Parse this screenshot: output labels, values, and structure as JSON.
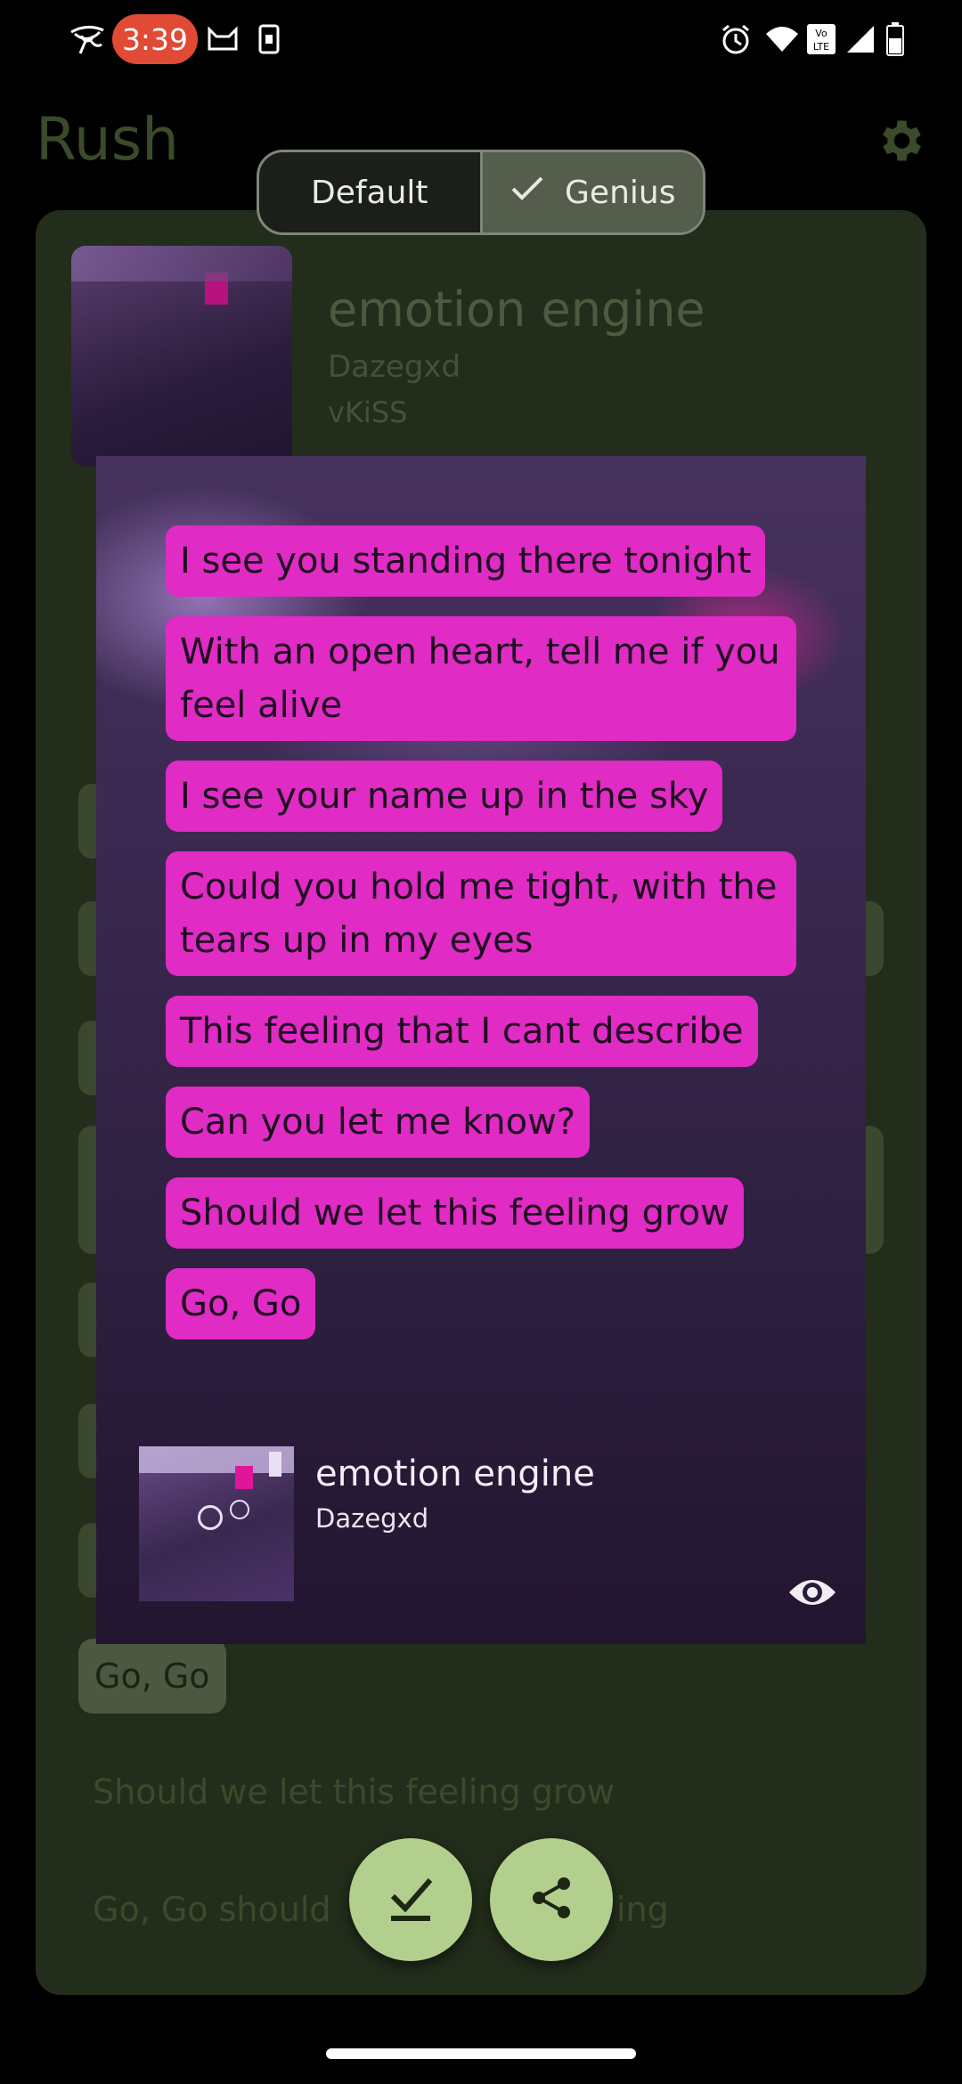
{
  "status_bar": {
    "time": "3:39",
    "icons": [
      "eye-of-horus-icon",
      "cat-icon",
      "sim-icon",
      "alarm-icon",
      "wifi-icon",
      "volte-icon",
      "signal-icon",
      "battery-icon"
    ]
  },
  "app": {
    "title": "Rush",
    "settings_icon": "gear-icon"
  },
  "source_toggle": {
    "options": [
      {
        "label": "Default",
        "selected": false
      },
      {
        "label": "Genius",
        "selected": true
      }
    ]
  },
  "song": {
    "title": "emotion engine",
    "artist": "Dazegxd",
    "album": "vKiSS"
  },
  "background_lyrics": {
    "chip": "Go, Go",
    "line1": "Should we let this feeling grow",
    "line2_start": "Go, Go should",
    "line2_end": "ing"
  },
  "preview": {
    "lyrics": [
      "I see you standing there tonight",
      "With an open heart, tell me if you feel alive",
      "I see your name up in the sky",
      "Could you hold me tight, with the tears up in my eyes",
      "This feeling that I cant describe",
      "Can you let me know?",
      "Should we let this feeling grow",
      "Go, Go"
    ],
    "song_title": "emotion engine",
    "artist": "Dazegxd",
    "visibility_icon": "eye-icon"
  },
  "actions": {
    "save_icon": "download-check-icon",
    "share_icon": "share-icon"
  },
  "colors": {
    "lyric_bg": "#e02bc4",
    "fab_bg": "#b3cf8d",
    "card_bg": "#232d1b",
    "clock_pill": "#e14a35"
  }
}
